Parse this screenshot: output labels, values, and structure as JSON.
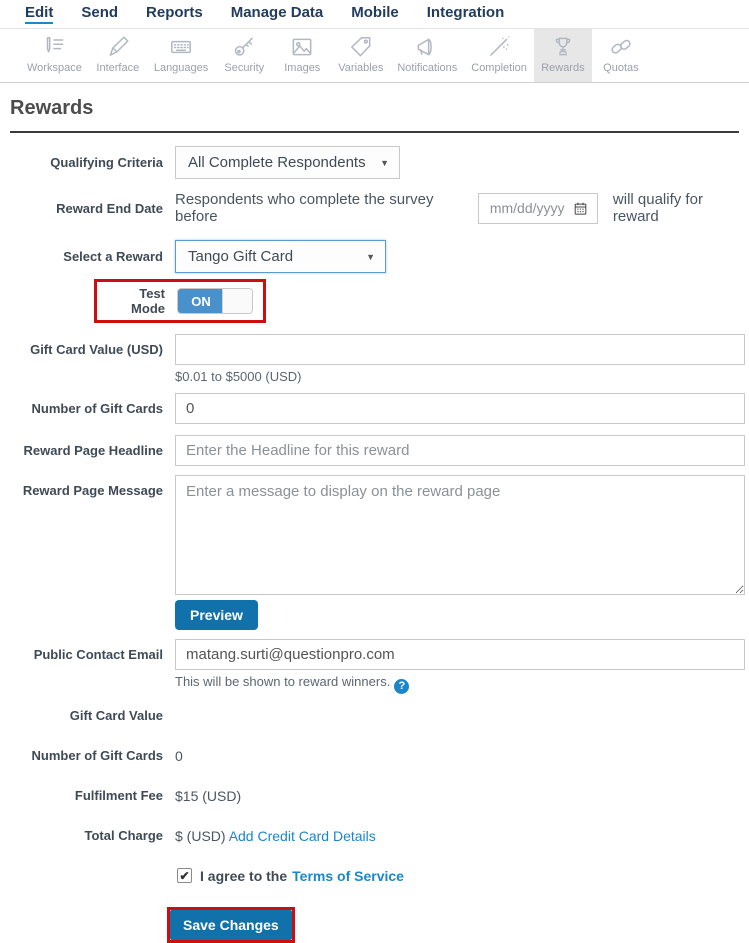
{
  "colors": {
    "accent_blue": "#1b87c9",
    "button_blue": "#1172ab",
    "toggle_blue": "#4a91cb",
    "highlight_red": "#cc0e0e",
    "active_tab_bg": "#e7e7e7"
  },
  "nav": {
    "items": [
      {
        "label": "Edit",
        "active": true
      },
      {
        "label": "Send",
        "active": false
      },
      {
        "label": "Reports",
        "active": false
      },
      {
        "label": "Manage Data",
        "active": false
      },
      {
        "label": "Mobile",
        "active": false
      },
      {
        "label": "Integration",
        "active": false
      }
    ]
  },
  "toolbar": {
    "items": [
      {
        "label": "Workspace",
        "icon": "workspace-icon",
        "active": false
      },
      {
        "label": "Interface",
        "icon": "interface-icon",
        "active": false
      },
      {
        "label": "Languages",
        "icon": "languages-icon",
        "active": false
      },
      {
        "label": "Security",
        "icon": "security-icon",
        "active": false
      },
      {
        "label": "Images",
        "icon": "images-icon",
        "active": false
      },
      {
        "label": "Variables",
        "icon": "variables-icon",
        "active": false
      },
      {
        "label": "Notifications",
        "icon": "notifications-icon",
        "active": false
      },
      {
        "label": "Completion",
        "icon": "completion-icon",
        "active": false
      },
      {
        "label": "Rewards",
        "icon": "rewards-icon",
        "active": true
      },
      {
        "label": "Quotas",
        "icon": "quotas-icon",
        "active": false
      }
    ]
  },
  "page": {
    "title": "Rewards"
  },
  "form": {
    "qualifying_criteria": {
      "label": "Qualifying Criteria",
      "value": "All Complete Respondents"
    },
    "reward_end_date": {
      "label": "Reward End Date",
      "prefix": "Respondents who complete the survey before",
      "placeholder": "mm/dd/yyyy",
      "suffix": "will qualify for reward"
    },
    "select_reward": {
      "label": "Select a Reward",
      "value": "Tango Gift Card"
    },
    "test_mode": {
      "label": "Test Mode",
      "state": "ON"
    },
    "gift_card_value": {
      "label": "Gift Card Value (USD)",
      "value": "",
      "helper": "$0.01 to $5000 (USD)"
    },
    "number_of_gift_cards": {
      "label": "Number of Gift Cards",
      "value": "0"
    },
    "reward_page_headline": {
      "label": "Reward Page Headline",
      "placeholder": "Enter the Headline for this reward"
    },
    "reward_page_message": {
      "label": "Reward Page Message",
      "placeholder": "Enter a message to display on the reward page"
    },
    "preview_button": "Preview",
    "public_contact_email": {
      "label": "Public Contact Email",
      "value": "matang.surti@questionpro.com",
      "helper": "This will be shown to reward winners."
    },
    "summary": [
      {
        "label": "Gift Card Value",
        "value": ""
      },
      {
        "label": "Number of Gift Cards",
        "value": "0"
      },
      {
        "label": "Fulfilment Fee",
        "value": "$15 (USD)"
      },
      {
        "label": "Total Charge",
        "value": "$ (USD)",
        "link": "Add Credit Card Details"
      }
    ],
    "terms": {
      "text": "I agree to the",
      "link": "Terms of Service",
      "checked": true
    },
    "save_button": "Save Changes"
  }
}
